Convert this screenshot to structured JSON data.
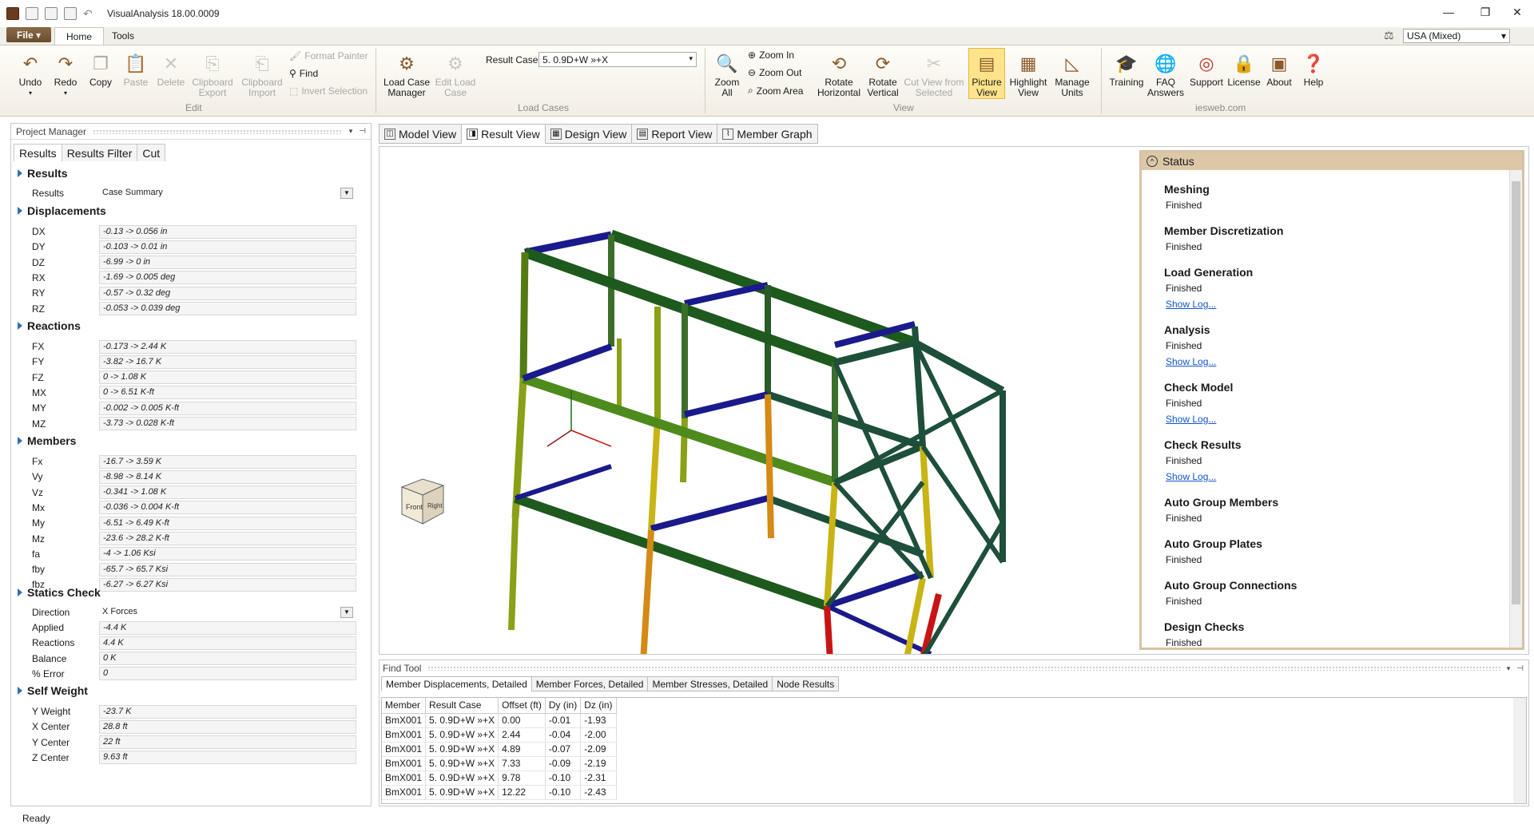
{
  "window": {
    "title": "VisualAnalysis 18.00.0009"
  },
  "menu": {
    "file": "File",
    "tabs": [
      "Home",
      "Tools"
    ]
  },
  "units": {
    "value": "USA (Mixed)"
  },
  "ribbon": {
    "edit": {
      "label": "Edit",
      "undo": "Undo",
      "redo": "Redo",
      "copy": "Copy",
      "paste": "Paste",
      "delete": "Delete",
      "clip_export": "Clipboard Export",
      "clip_import": "Clipboard Import",
      "format_painter": "Format Painter",
      "find": "Find",
      "invert_selection": "Invert Selection"
    },
    "load_cases": {
      "label": "Load Cases",
      "manager": "Load Case Manager",
      "edit": "Edit Load Case",
      "result_case_label": "Result Case",
      "result_case_value": "5. 0.9D+W »+X"
    },
    "view": {
      "label": "View",
      "zoom_all": "Zoom All",
      "zoom_in": "Zoom In",
      "zoom_out": "Zoom Out",
      "zoom_area": "Zoom Area",
      "rotate_h": "Rotate Horizontal",
      "rotate_v": "Rotate Vertical",
      "cut_view": "Cut View from Selected",
      "picture_view": "Picture View",
      "highlight_view": "Highlight View",
      "manage_units": "Manage Units"
    },
    "iesweb": {
      "label": "iesweb.com",
      "training": "Training",
      "faq": "FAQ Answers",
      "support": "Support",
      "license": "License",
      "about": "About",
      "help": "Help"
    }
  },
  "project_manager": {
    "title": "Project Manager",
    "tabs": [
      "Results",
      "Results Filter",
      "Cut"
    ],
    "results": {
      "title": "Results",
      "label": "Results",
      "value": "Case Summary"
    },
    "displacements": {
      "title": "Displacements",
      "rows": [
        [
          "DX",
          "-0.13 -> 0.056 in"
        ],
        [
          "DY",
          "-0.103 -> 0.01 in"
        ],
        [
          "DZ",
          "-6.99 -> 0 in"
        ],
        [
          "RX",
          "-1.69 -> 0.005 deg"
        ],
        [
          "RY",
          "-0.57 -> 0.32 deg"
        ],
        [
          "RZ",
          "-0.053 -> 0.039 deg"
        ]
      ]
    },
    "reactions": {
      "title": "Reactions",
      "rows": [
        [
          "FX",
          "-0.173 -> 2.44 K"
        ],
        [
          "FY",
          "-3.82 -> 16.7 K"
        ],
        [
          "FZ",
          "0 -> 1.08 K"
        ],
        [
          "MX",
          "0 -> 6.51 K-ft"
        ],
        [
          "MY",
          "-0.002 -> 0.005 K-ft"
        ],
        [
          "MZ",
          "-3.73 -> 0.028 K-ft"
        ]
      ]
    },
    "members": {
      "title": "Members",
      "rows": [
        [
          "Fx",
          "-16.7 -> 3.59 K"
        ],
        [
          "Vy",
          "-8.98 -> 8.14 K"
        ],
        [
          "Vz",
          "-0.341 -> 1.08 K"
        ],
        [
          "Mx",
          "-0.036 -> 0.004 K-ft"
        ],
        [
          "My",
          "-6.51 -> 6.49 K-ft"
        ],
        [
          "Mz",
          "-23.6 -> 28.2 K-ft"
        ],
        [
          "fa",
          "-4 -> 1.06 Ksi"
        ],
        [
          "fby",
          "-65.7 -> 65.7 Ksi"
        ],
        [
          "fbz",
          "-6.27 -> 6.27 Ksi"
        ]
      ]
    },
    "statics": {
      "title": "Statics Check",
      "direction_label": "Direction",
      "direction_value": "X Forces",
      "rows": [
        [
          "Applied",
          "-4.4 K"
        ],
        [
          "Reactions",
          "4.4 K"
        ],
        [
          "Balance",
          "0 K"
        ],
        [
          "% Error",
          "0"
        ]
      ]
    },
    "self_weight": {
      "title": "Self Weight",
      "rows": [
        [
          "Y Weight",
          "-23.7 K"
        ],
        [
          "X Center",
          "28.8 ft"
        ],
        [
          "Y Center",
          "22 ft"
        ],
        [
          "Z Center",
          "9.63 ft"
        ]
      ]
    }
  },
  "view_tabs": [
    "Model View",
    "Result View",
    "Design View",
    "Report View",
    "Member Graph"
  ],
  "viewcube": {
    "front": "Front",
    "right": "Right"
  },
  "status_panel": {
    "title": "Status",
    "items": [
      {
        "title": "Meshing",
        "value": "Finished",
        "log": ""
      },
      {
        "title": "Member Discretization",
        "value": "Finished",
        "log": ""
      },
      {
        "title": "Load Generation",
        "value": "Finished",
        "log": "Show Log..."
      },
      {
        "title": "Analysis",
        "value": "Finished",
        "log": "Show Log..."
      },
      {
        "title": "Check Model",
        "value": "Finished",
        "log": "Show Log..."
      },
      {
        "title": "Check Results",
        "value": "Finished",
        "log": "Show Log..."
      },
      {
        "title": "Auto Group Members",
        "value": "Finished",
        "log": ""
      },
      {
        "title": "Auto Group Plates",
        "value": "Finished",
        "log": ""
      },
      {
        "title": "Auto Group Connections",
        "value": "Finished",
        "log": ""
      },
      {
        "title": "Design Checks",
        "value": "Finished",
        "log": ""
      }
    ]
  },
  "find_tool": {
    "title": "Find Tool",
    "tabs": [
      "Member Displacements, Detailed",
      "Member Forces, Detailed",
      "Member Stresses, Detailed",
      "Node Results"
    ],
    "columns": [
      "Member",
      "Result Case",
      "Offset (ft)",
      "Dy (in)",
      "Dz (in)"
    ],
    "rows": [
      [
        "BmX001",
        "5. 0.9D+W »+X",
        "0.00",
        "-0.01",
        "-1.93"
      ],
      [
        "BmX001",
        "5. 0.9D+W »+X",
        "2.44",
        "-0.04",
        "-2.00"
      ],
      [
        "BmX001",
        "5. 0.9D+W »+X",
        "4.89",
        "-0.07",
        "-2.09"
      ],
      [
        "BmX001",
        "5. 0.9D+W »+X",
        "7.33",
        "-0.09",
        "-2.19"
      ],
      [
        "BmX001",
        "5. 0.9D+W »+X",
        "9.78",
        "-0.10",
        "-2.31"
      ],
      [
        "BmX001",
        "5. 0.9D+W »+X",
        "12.22",
        "-0.10",
        "-2.43"
      ]
    ]
  },
  "statusbar": {
    "text": "Ready"
  }
}
